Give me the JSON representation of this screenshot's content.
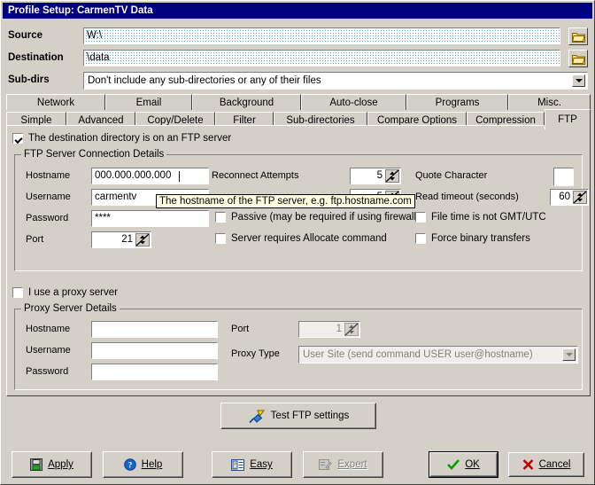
{
  "window": {
    "title": "Profile Setup: CarmenTV Data"
  },
  "top_fields": {
    "source": {
      "label": "Source",
      "value": "W:\\",
      "browse_icon": "folder-icon"
    },
    "destination": {
      "label": "Destination",
      "value": "\\data",
      "browse_icon": "folder-icon"
    },
    "subdirs": {
      "label": "Sub-dirs",
      "value": "Don't include any sub-directories or any of their files"
    }
  },
  "tabs_row1": [
    {
      "label": "Network"
    },
    {
      "label": "Email"
    },
    {
      "label": "Background"
    },
    {
      "label": "Auto-close"
    },
    {
      "label": "Programs"
    },
    {
      "label": "Misc."
    }
  ],
  "tabs_row2": [
    {
      "label": "Simple"
    },
    {
      "label": "Advanced"
    },
    {
      "label": "Copy/Delete"
    },
    {
      "label": "Filter"
    },
    {
      "label": "Sub-directories"
    },
    {
      "label": "Compare Options"
    },
    {
      "label": "Compression"
    },
    {
      "label": "FTP"
    }
  ],
  "ftp": {
    "enable_checkbox": {
      "label": "The destination directory is on an FTP server",
      "checked": true
    },
    "group_title": "FTP Server Connection Details",
    "hostname": {
      "label": "Hostname",
      "value": "000.000.000.000"
    },
    "username": {
      "label": "Username",
      "value": "carmentv"
    },
    "password": {
      "label": "Password",
      "value": "****"
    },
    "port": {
      "label": "Port",
      "value": "21"
    },
    "reconnect_attempts": {
      "label": "Reconnect Attempts",
      "value": "5"
    },
    "reconnect_delay": {
      "label": "",
      "value": "5"
    },
    "quote_character": {
      "label": "Quote Character",
      "value": ""
    },
    "read_timeout": {
      "label": "Read timeout (seconds)",
      "value": "60"
    },
    "passive": {
      "label": "Passive (may be required if using firewall)",
      "checked": false
    },
    "allocate": {
      "label": "Server requires Allocate command",
      "checked": false
    },
    "gmt": {
      "label": "File time is not GMT/UTC",
      "checked": false
    },
    "binary": {
      "label": "Force binary transfers",
      "checked": false
    }
  },
  "tooltip": {
    "text": "The hostname of the FTP server, e.g. ftp.hostname.com"
  },
  "proxy": {
    "enable_checkbox": {
      "label": "I use a proxy server",
      "checked": false
    },
    "group_title": "Proxy Server Details",
    "hostname": {
      "label": "Hostname",
      "value": ""
    },
    "username": {
      "label": "Username",
      "value": ""
    },
    "password": {
      "label": "Password",
      "value": ""
    },
    "port": {
      "label": "Port",
      "value": "1"
    },
    "proxy_type": {
      "label": "Proxy Type",
      "value": "User Site (send command USER user@hostname)"
    }
  },
  "test_button": {
    "label": "Test FTP settings",
    "icon": "plug-connector-icon"
  },
  "footer": {
    "apply": {
      "label": "Apply",
      "icon": "floppy-disk-icon"
    },
    "help": {
      "label": "Help",
      "icon": "question-circle-icon"
    },
    "easy": {
      "label": "Easy",
      "icon": "id-card-icon"
    },
    "expert": {
      "label": "Expert",
      "icon": "pencil-form-icon",
      "disabled": true
    },
    "ok": {
      "label": "OK",
      "icon": "green-check-icon"
    },
    "cancel": {
      "label": "Cancel",
      "icon": "red-x-icon"
    }
  },
  "colors": {
    "titlebar": "#000080",
    "face": "#d4d0c8",
    "tooltip_bg": "#ffffe1",
    "ok_check": "#00a000",
    "cancel_x": "#c00000"
  }
}
